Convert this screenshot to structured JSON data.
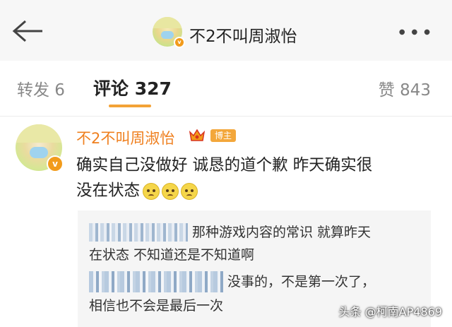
{
  "header": {
    "back_label": "←",
    "title": "不2不叫周淑怡",
    "more_label": "●●●",
    "verified_badge": "v"
  },
  "tabs": {
    "repost": "转发 6",
    "comment": "评论 327",
    "like": "赞 843",
    "active_color": "#f3a236"
  },
  "comment": {
    "author": "不2不叫周淑怡",
    "author_color": "#ef7f1e",
    "badge": "博主",
    "verified_badge": "v",
    "text_line1": "确实自己没做好 诚恳的道个歉 昨天确实很",
    "text_line2": "没在状态",
    "emoji_count": 3
  },
  "replies": {
    "reply1_line1": "那种游戏内容的常识 就算昨天",
    "reply1_line2": "在状态 不知道还是不知道啊",
    "reply2_line1": "没事的，不是第一次了，",
    "reply2_line2": "相信也不会是最后一次"
  },
  "watermark": "头条 @柯南AP4869"
}
